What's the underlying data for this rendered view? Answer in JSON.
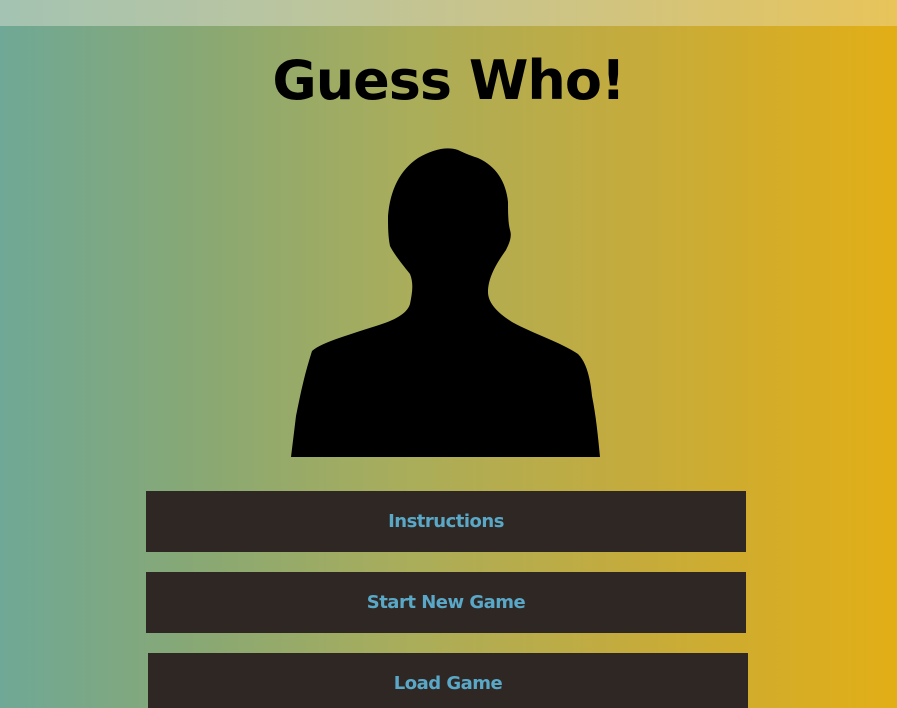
{
  "app": {
    "title": "Guess Who!"
  },
  "menu": {
    "instructions_label": "Instructions",
    "start_new_game_label": "Start New Game",
    "load_game_label": "Load Game"
  },
  "colors": {
    "button_background": "#2f2724",
    "button_text": "#5aa8c8",
    "gradient_left": "#6fa896",
    "gradient_right": "#e2ae16"
  },
  "icons": {
    "hero": "person-silhouette-icon"
  }
}
